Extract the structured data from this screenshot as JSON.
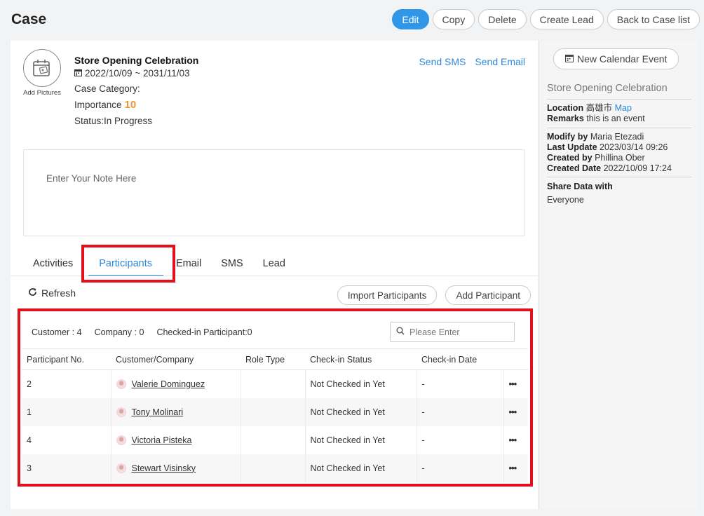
{
  "page": {
    "title": "Case"
  },
  "top_actions": {
    "edit": "Edit",
    "copy": "Copy",
    "delete": "Delete",
    "create_lead": "Create Lead",
    "back": "Back to Case list"
  },
  "case": {
    "add_pictures": "Add Pictures",
    "name": "Store Opening Celebration",
    "dates": "2022/10/09 ~ 2031/11/03",
    "category_label": "Case Category:",
    "importance_label": "Importance",
    "importance_value": "10",
    "status": "Status:In Progress",
    "send_sms": "Send SMS",
    "send_email": "Send Email",
    "note_placeholder": "Enter Your Note Here"
  },
  "tabs": [
    "Activities",
    "Participants",
    "Email",
    "SMS",
    "Lead"
  ],
  "toolbar": {
    "refresh": "Refresh",
    "import": "Import Participants",
    "add": "Add Participant"
  },
  "participants": {
    "stats": {
      "customer": "Customer : 4",
      "company": "Company : 0",
      "checked_in": "Checked-in Participant:0"
    },
    "search_placeholder": "Please Enter",
    "columns": [
      "Participant No.",
      "Customer/Company",
      "Role Type",
      "Check-in Status",
      "Check-in Date"
    ],
    "rows": [
      {
        "no": "2",
        "name": "Valerie Dominguez",
        "role": "",
        "status": "Not Checked in Yet",
        "date": "-"
      },
      {
        "no": "1",
        "name": "Tony Molinari",
        "role": "",
        "status": "Not Checked in Yet",
        "date": "-"
      },
      {
        "no": "4",
        "name": "Victoria Pisteka",
        "role": "",
        "status": "Not Checked in Yet",
        "date": "-"
      },
      {
        "no": "3",
        "name": "Stewart Visinsky",
        "role": "",
        "status": "Not Checked in Yet",
        "date": "-"
      }
    ],
    "more_label": "•••"
  },
  "sidebar": {
    "new_event": "New Calendar Event",
    "title": "Store Opening Celebration",
    "location_label": "Location",
    "location_value": "高雄市",
    "map": "Map",
    "remarks_label": "Remarks",
    "remarks_value": "this is an event",
    "modify_label": "Modify by",
    "modify_value": "Maria Etezadi",
    "update_label": "Last Update",
    "update_value": "2023/03/14 09:26",
    "created_by_label": "Created by",
    "created_by_value": "Phillina Ober",
    "created_date_label": "Created Date",
    "created_date_value": "2022/10/09 17:24",
    "share_label": "Share Data with",
    "share_value": "Everyone"
  },
  "colors": {
    "accent": "#2f96e8",
    "highlight": "#e0101c",
    "importance": "#f0962c"
  }
}
